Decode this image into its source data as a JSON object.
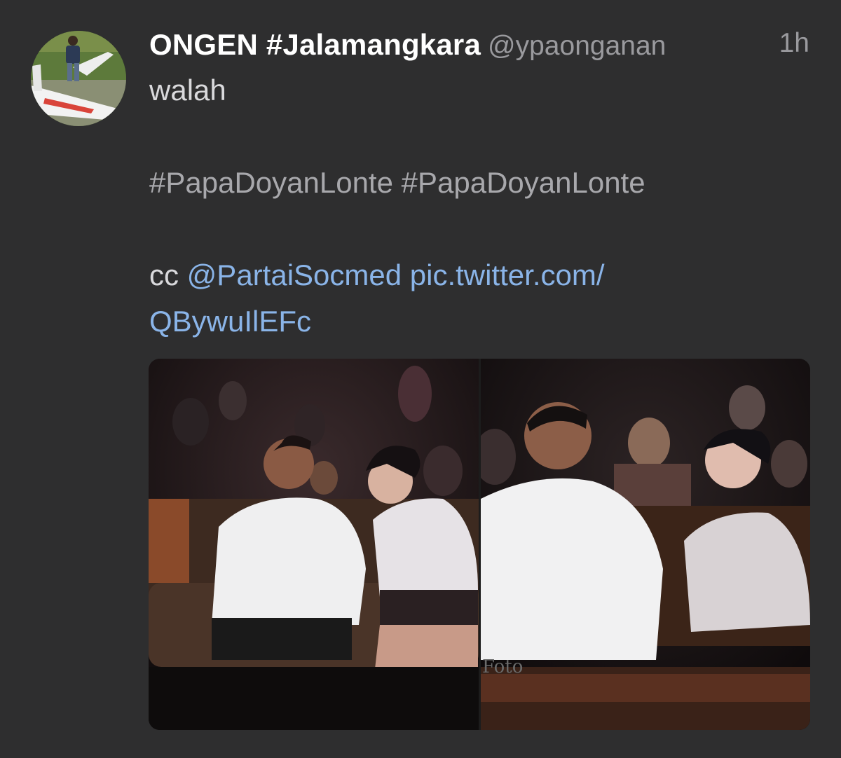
{
  "tweet": {
    "author_name": "ONGEN #Jalamangkara",
    "author_handle": "@ypaonganan",
    "timestamp": "1h",
    "lines": {
      "line1": "walah",
      "hashtag1": "#PapaDoyanLonte",
      "hashtag2": "#PapaDoyanLonte",
      "cc": "cc",
      "mention": "@PartaiSocmed",
      "link_part1": "pic.twitter.com/",
      "link_part2": "QBywuIlEFc"
    }
  },
  "colors": {
    "background": "#2e2e2f",
    "name": "#ffffff",
    "handle": "#9a9a9e",
    "link": "#8ab4e8"
  },
  "icons": {
    "avatar": "avatar-photo-airplane"
  },
  "media": {
    "count": 2,
    "watermark": "Foto"
  }
}
